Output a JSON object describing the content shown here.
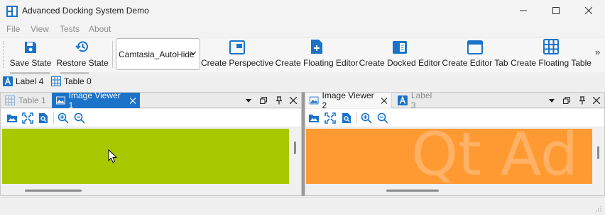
{
  "window": {
    "title": "Advanced Docking System Demo"
  },
  "menu": [
    "File",
    "View",
    "Tests",
    "About"
  ],
  "toolbar": {
    "save_state": "Save State",
    "restore_state": "Restore State",
    "perspective_combo": "Camtasia_AutoHide",
    "create_perspective": "Create Perspective",
    "create_floating_editor": "Create Floating Editor",
    "create_docked_editor": "Create Docked Editor",
    "create_editor_tab": "Create Editor Tab",
    "create_floating_table": "Create Floating Table",
    "overflow": "»"
  },
  "autohide": {
    "tabs": [
      "Label 4",
      "Table 0"
    ]
  },
  "left_dock": {
    "tabs": [
      {
        "label": "Table 1",
        "state": "inactive"
      },
      {
        "label": "Image Viewer 1",
        "state": "active"
      }
    ],
    "canvas_color": "#a8c800"
  },
  "right_dock": {
    "tabs": [
      {
        "label": "Image Viewer 2",
        "state": "active"
      },
      {
        "label": "Label 3",
        "state": "inactive"
      }
    ],
    "canvas_color": "#ff9a33",
    "watermark": "Qt Ad"
  },
  "colors": {
    "accent": "#1a73c9",
    "icon_blue": "#1a73c9"
  }
}
